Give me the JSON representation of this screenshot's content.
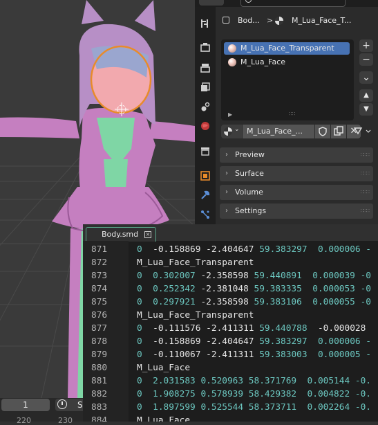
{
  "colors": {
    "accent_blue": "#4772b3",
    "model_pink": "#c57fc0",
    "model_green": "#7fd6a5",
    "outline_orange": "#e88b2a",
    "number_teal": "#6cc7c0",
    "tab_border": "#5aa88c"
  },
  "timeline": {
    "frame": "1",
    "clock_label": "S",
    "ruler": [
      "220",
      "230"
    ]
  },
  "properties": {
    "tab_icons": [
      "tool-icon",
      "render-icon",
      "output-icon",
      "view-layer-icon",
      "scene-icon",
      "world-icon",
      "collection-icon",
      "object-icon",
      "modifier-icon",
      "particles-icon"
    ],
    "breadcrumb": {
      "object": "Bod...",
      "separator": ">",
      "material": "M_Lua_Face_T..."
    },
    "slots": [
      {
        "name": "M_Lua_Face_Transparent",
        "selected": true
      },
      {
        "name": "M_Lua_Face",
        "selected": false
      }
    ],
    "side_buttons": [
      "+",
      "−",
      "⌄",
      "▲",
      "▼"
    ],
    "material_name": "M_Lua_Face_...",
    "panels": [
      "Preview",
      "Surface",
      "Volume",
      "Settings"
    ]
  },
  "text_editor": {
    "tab_name": "Body.smd",
    "lines": [
      {
        "num": "871",
        "parts": [
          {
            "t": "0  ",
            "c": "n"
          },
          {
            "t": "-0.158869 -2.404647 ",
            "c": "w"
          },
          {
            "t": "59.383297  0.000006 -",
            "c": "n"
          }
        ]
      },
      {
        "num": "872",
        "parts": [
          {
            "t": "M_Lua_Face_Transparent",
            "c": "w"
          }
        ]
      },
      {
        "num": "873",
        "parts": [
          {
            "t": "0  0.302007 ",
            "c": "n"
          },
          {
            "t": "-2.358598 ",
            "c": "w"
          },
          {
            "t": "59.440891  0.000039 -0",
            "c": "n"
          }
        ]
      },
      {
        "num": "874",
        "parts": [
          {
            "t": "0  0.252342 ",
            "c": "n"
          },
          {
            "t": "-2.381048 ",
            "c": "w"
          },
          {
            "t": "59.383335  0.000053 -0",
            "c": "n"
          }
        ]
      },
      {
        "num": "875",
        "parts": [
          {
            "t": "0  0.297921 ",
            "c": "n"
          },
          {
            "t": "-2.358598 ",
            "c": "w"
          },
          {
            "t": "59.383106  0.000055 -0",
            "c": "n"
          }
        ]
      },
      {
        "num": "876",
        "parts": [
          {
            "t": "M_Lua_Face_Transparent",
            "c": "w"
          }
        ]
      },
      {
        "num": "877",
        "parts": [
          {
            "t": "0  ",
            "c": "n"
          },
          {
            "t": "-0.111576 -2.411311 ",
            "c": "w"
          },
          {
            "t": "59.440788  ",
            "c": "n"
          },
          {
            "t": "-0.000028 ",
            "c": "w"
          }
        ]
      },
      {
        "num": "878",
        "parts": [
          {
            "t": "0  ",
            "c": "n"
          },
          {
            "t": "-0.158869 -2.404647 ",
            "c": "w"
          },
          {
            "t": "59.383297  0.000006 -",
            "c": "n"
          }
        ]
      },
      {
        "num": "879",
        "parts": [
          {
            "t": "0  ",
            "c": "n"
          },
          {
            "t": "-0.110067 -2.411311 ",
            "c": "w"
          },
          {
            "t": "59.383003  0.000005 -",
            "c": "n"
          }
        ]
      },
      {
        "num": "880",
        "parts": [
          {
            "t": "M_Lua_Face",
            "c": "w"
          }
        ]
      },
      {
        "num": "881",
        "parts": [
          {
            "t": "0  2.031583 0.520963 58.371769  0.005144 -0.",
            "c": "n"
          }
        ]
      },
      {
        "num": "882",
        "parts": [
          {
            "t": "0  1.908275 0.578939 58.429382  0.004822 -0.",
            "c": "n"
          }
        ]
      },
      {
        "num": "883",
        "parts": [
          {
            "t": "0  1.897599 0.525544 58.373711  0.002264 -0.",
            "c": "n"
          }
        ]
      },
      {
        "num": "884",
        "parts": [
          {
            "t": "M_Lua_Face",
            "c": "w"
          }
        ]
      }
    ]
  }
}
